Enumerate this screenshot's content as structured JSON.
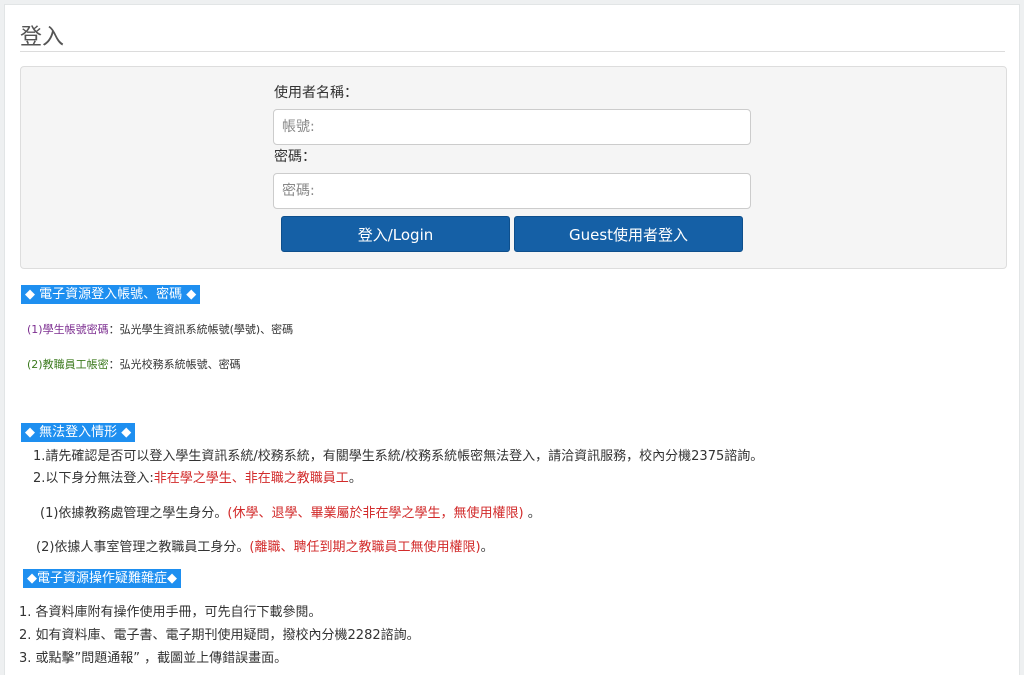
{
  "page": {
    "title": "登入"
  },
  "login": {
    "username_label": "使用者名稱：",
    "username_placeholder": "帳號:",
    "password_label": "密碼：",
    "password_placeholder": "密碼:",
    "login_button": "登入/Login",
    "guest_button": "Guest使用者登入"
  },
  "section1": {
    "heading": "◆ 電子資源登入帳號、密碼 ◆",
    "item1_label": "(1)學生帳號密碼",
    "item1_text": "：弘光學生資訊系統帳號(學號)、密碼",
    "item2_label": "(2)教職員工帳密",
    "item2_text": "：弘光校務系統帳號、密碼"
  },
  "section2": {
    "heading": "◆ 無法登入情形 ◆",
    "line1": "1.請先確認是否可以登入學生資訊系統/校務系統，有關學生系統/校務系統帳密無法登入，請洽資訊服務，校內分機2375諮詢。",
    "line2_prefix": "2.以下身分無法登入:",
    "line2_red": "非在學之學生、非在職之教職員工",
    "line2_suffix": "。",
    "sub1_prefix": "(1)依據教務處管理之學生身分。",
    "sub1_red": "(休學、退學、畢業屬於非在學之學生，無使用權限)",
    "sub1_suffix": "  。",
    "sub2_prefix": "(2)依據人事室管理之教職員工身分。",
    "sub2_red": "(離職、聘任到期之教職員工無使用權限)",
    "sub2_suffix": "。"
  },
  "section3": {
    "heading": "◆電子資源操作疑難雜症◆",
    "line1": "1. 各資料庫附有操作使用手冊，可先自行下載參閱。",
    "line2": "2. 如有資料庫、電子書、電子期刊使用疑問，撥校內分機2282諮詢。",
    "line3": "3. 或點擊”問題通報”  ，截圖並上傳錯誤畫面。"
  },
  "colors": {
    "button_blue": "#1560a6",
    "highlight_blue": "#1e8ff0",
    "warning_red": "#d22b2b"
  }
}
